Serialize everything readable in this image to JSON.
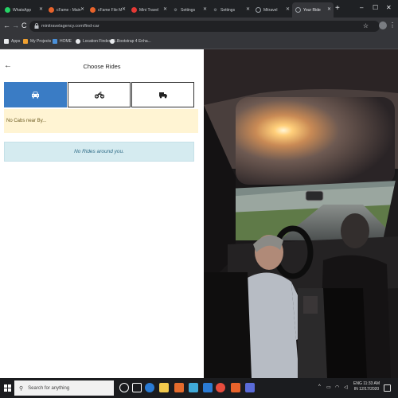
{
  "browser": {
    "tabs": [
      {
        "label": "WhatsApp",
        "icon": "whatsapp-icon",
        "color": "#25d366"
      },
      {
        "label": "cFame - Main",
        "icon": "cfame-icon",
        "color": "#e8632b"
      },
      {
        "label": "cFame File M",
        "icon": "cfame-icon",
        "color": "#e8632b"
      },
      {
        "label": "Mini Travel",
        "icon": "mini-travel-icon",
        "color": "#e53935"
      },
      {
        "label": "Settings",
        "icon": "gear-icon",
        "color": "#9aa0a6"
      },
      {
        "label": "Settings",
        "icon": "gear-icon",
        "color": "#9aa0a6"
      },
      {
        "label": "Mitravel",
        "icon": "globe-icon",
        "color": "#9aa0a6"
      },
      {
        "label": "Your Ride",
        "icon": "globe-icon",
        "color": "#9aa0a6"
      }
    ],
    "new_tab": "+",
    "url": "minitravelagency.com/find-car",
    "bookmarks": [
      {
        "label": "Apps",
        "color": "#e8eaed"
      },
      {
        "label": "My Projects",
        "color": "#f0a030"
      },
      {
        "label": "HOME",
        "color": "#4a90d9"
      },
      {
        "label": "Location Finder: R...",
        "color": "#e8eaed"
      },
      {
        "label": "Bootstrap 4 Enha...",
        "color": "#e8eaed"
      }
    ]
  },
  "page": {
    "title": "Choose Rides",
    "ride_tabs": [
      {
        "name": "car",
        "icon": "car-icon",
        "active": true
      },
      {
        "name": "bike",
        "icon": "motorcycle-icon",
        "active": false
      },
      {
        "name": "truck",
        "icon": "truck-icon",
        "active": false
      }
    ],
    "warning_text": "No Cabs near By...",
    "info_text": "No Rides around you.",
    "hero_image": "car-interior-sunset-photo"
  },
  "taskbar": {
    "search_placeholder": "Search for anything",
    "time": "11:33 AM",
    "date": "12/17/2020",
    "lang": "ENG",
    "lang_sub": "IN"
  }
}
